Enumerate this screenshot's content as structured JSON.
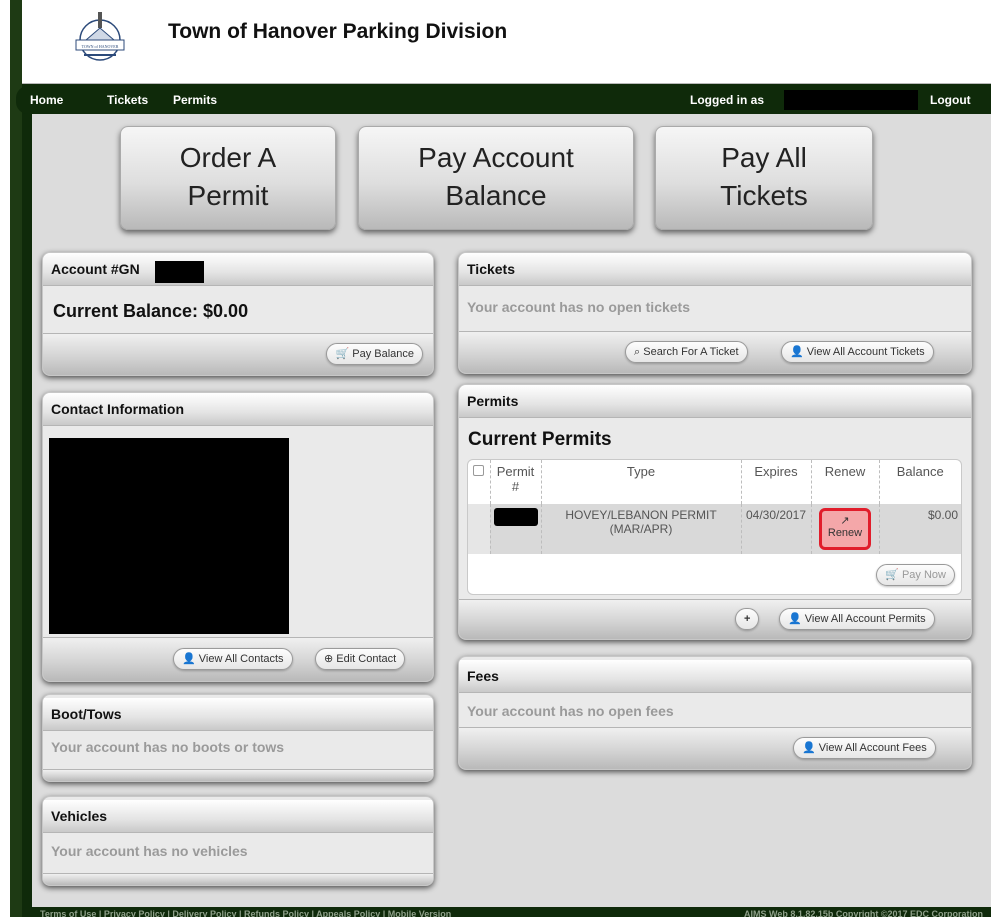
{
  "header": {
    "title": "Town of Hanover Parking Division",
    "logo_alt": "Town of Hanover seal"
  },
  "nav": {
    "links": [
      "Home",
      "Tickets",
      "Permits"
    ],
    "logged_in_label": "Logged in as",
    "logout": "Logout"
  },
  "actions": {
    "order_permit": [
      "Order A",
      "Permit"
    ],
    "pay_balance": [
      "Pay Account",
      "Balance"
    ],
    "pay_tickets": [
      "Pay All",
      "Tickets"
    ]
  },
  "account": {
    "title": "Account #GN",
    "balance": "Current Balance: $0.00",
    "pay_balance_btn": "Pay Balance"
  },
  "contact": {
    "title": "Contact Information",
    "view_all_btn": "View All Contacts",
    "edit_btn": "Edit Contact"
  },
  "boot_tows": {
    "title": "Boot/Tows",
    "empty": "Your account has no boots or tows"
  },
  "vehicles": {
    "title": "Vehicles",
    "empty": "Your account has no vehicles"
  },
  "tickets": {
    "title": "Tickets",
    "empty": "Your account has no open tickets",
    "search_btn": "Search For A Ticket",
    "view_all_btn": "View All Account Tickets"
  },
  "permits": {
    "title": "Permits",
    "subtitle": "Current Permits",
    "columns": [
      "Permit #",
      "Type",
      "Expires",
      "Renew",
      "Balance"
    ],
    "rows": [
      {
        "type": "HOVEY/LEBANON PERMIT (MAR/APR)",
        "expires": "04/30/2017",
        "renew": "Renew",
        "balance": "$0.00"
      }
    ],
    "pay_now_btn": "Pay Now",
    "add_btn": "+",
    "view_all_btn": "View All Account Permits"
  },
  "fees": {
    "title": "Fees",
    "empty": "Your account has no open fees",
    "view_all_btn": "View All Account Fees"
  },
  "footer": {
    "links": "Terms of Use | Privacy Policy | Delivery Policy | Refunds Policy | Appeals Policy | Mobile Version",
    "copyright": "AIMS Web 8.1.82.15b Copyright ©2017 EDC Corporation"
  },
  "colors": {
    "nav_bg": "#0f2a0a",
    "renew_highlight": "#e11d2b",
    "renew_fill": "#f4a7a9"
  }
}
